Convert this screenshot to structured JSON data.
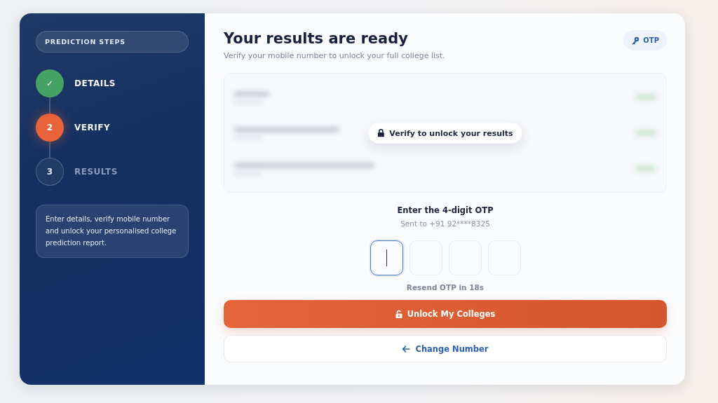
{
  "sidebar": {
    "heading": "PREDICTION STEPS",
    "steps": [
      {
        "marker": "✓",
        "label": "DETAILS",
        "completed": true,
        "current": false
      },
      {
        "marker": "2",
        "label": "VERIFY",
        "completed": false,
        "current": true
      },
      {
        "marker": "3",
        "label": "RESULTS",
        "completed": false,
        "current": false
      }
    ],
    "note": "Enter details, verify mobile number and unlock your personalised college prediction report."
  },
  "main": {
    "title": "Your results are ready",
    "subtitle": "Verify your mobile number to unlock your full college list.",
    "badge": "OTP",
    "locked_preview": {
      "overlay": "Verify to unlock your results"
    },
    "otp": {
      "label": "Enter the 4-digit OTP",
      "sent_to": "Sent to +91 92****8325",
      "digits": [
        {
          "focused": true
        },
        {
          "focused": false
        },
        {
          "focused": false
        },
        {
          "focused": false
        }
      ],
      "resend": "Resend OTP in 18s"
    },
    "primary_button": "Unlock My Colleges",
    "secondary_button": "Change Number"
  }
}
